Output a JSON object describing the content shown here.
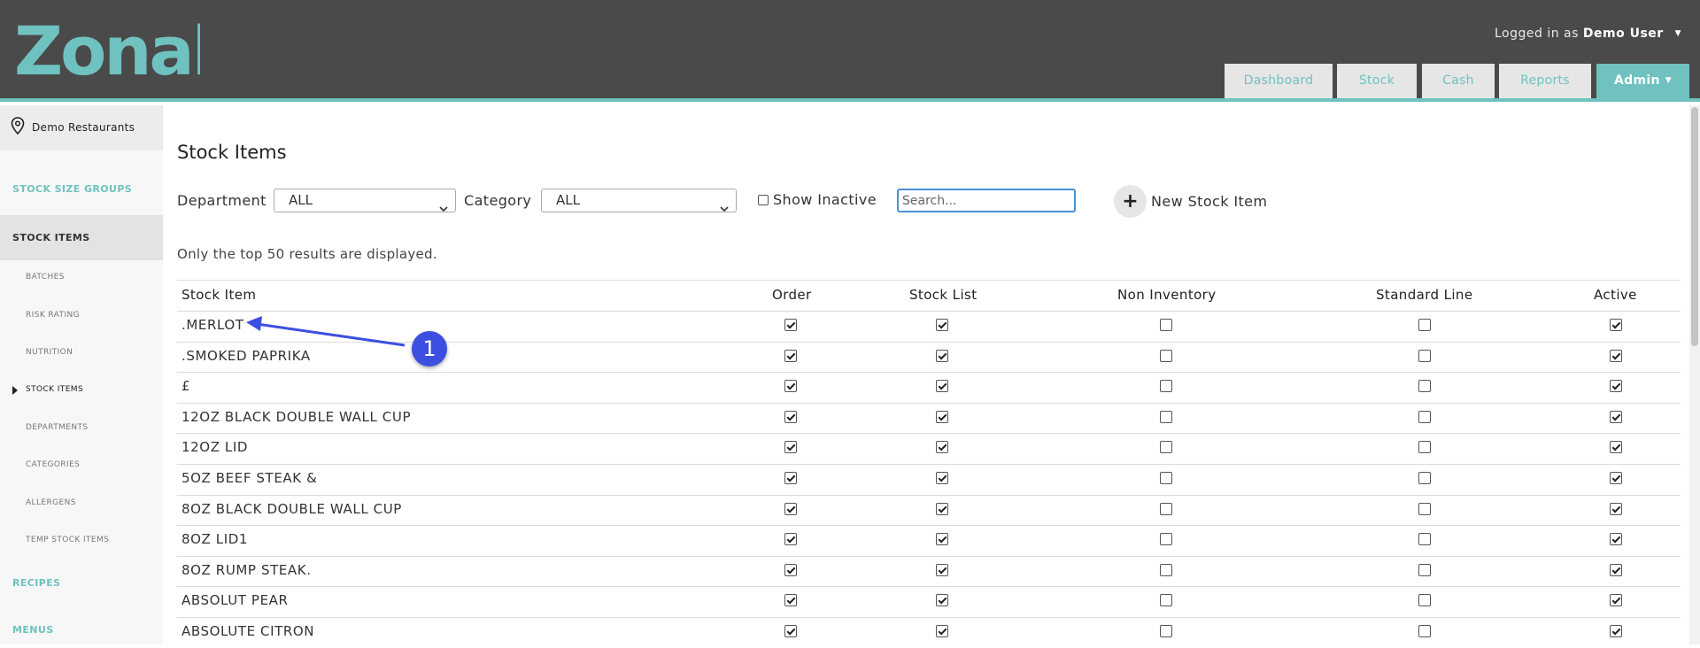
{
  "brand": {
    "logo_text": "Zonal"
  },
  "header": {
    "logged_in_prefix": "Logged in as",
    "user_name": "Demo User",
    "tabs": [
      {
        "label": "Dashboard"
      },
      {
        "label": "Stock"
      },
      {
        "label": "Cash"
      },
      {
        "label": "Reports"
      },
      {
        "label": "Admin",
        "active": true
      }
    ]
  },
  "sidebar": {
    "location": "Demo Restaurants",
    "sections": [
      {
        "label": "STOCK SIZE GROUPS"
      },
      {
        "label": "STOCK ITEMS",
        "selected": true
      },
      {
        "label": "RECIPES"
      },
      {
        "label": "MENUS"
      }
    ],
    "subitems": [
      {
        "label": "BATCHES"
      },
      {
        "label": "RISK RATING"
      },
      {
        "label": "NUTRITION"
      },
      {
        "label": "STOCK ITEMS",
        "current": true
      },
      {
        "label": "DEPARTMENTS"
      },
      {
        "label": "CATEGORIES"
      },
      {
        "label": "ALLERGENS"
      },
      {
        "label": "TEMP STOCK ITEMS"
      }
    ]
  },
  "main": {
    "title": "Stock Items",
    "filters": {
      "department_label": "Department",
      "department_value": "ALL",
      "category_label": "Category",
      "category_value": "ALL",
      "show_inactive_label": "Show Inactive",
      "show_inactive_checked": false,
      "search_placeholder": "Search...",
      "new_button_label": "New Stock Item"
    },
    "note": "Only the top 50 results are displayed.",
    "table": {
      "columns": [
        "Stock Item",
        "Order",
        "Stock List",
        "Non Inventory",
        "Standard Line",
        "Active"
      ],
      "rows": [
        {
          "name": ".MERLOT",
          "order": true,
          "stock_list": true,
          "non_inventory": false,
          "standard_line": false,
          "active": true
        },
        {
          "name": ".SMOKED PAPRIKA",
          "order": true,
          "stock_list": true,
          "non_inventory": false,
          "standard_line": false,
          "active": true
        },
        {
          "name": "£",
          "order": true,
          "stock_list": true,
          "non_inventory": false,
          "standard_line": false,
          "active": true
        },
        {
          "name": "12OZ BLACK DOUBLE WALL CUP",
          "order": true,
          "stock_list": true,
          "non_inventory": false,
          "standard_line": false,
          "active": true
        },
        {
          "name": "12OZ LID",
          "order": true,
          "stock_list": true,
          "non_inventory": false,
          "standard_line": false,
          "active": true
        },
        {
          "name": "5OZ BEEF STEAK &",
          "order": true,
          "stock_list": true,
          "non_inventory": false,
          "standard_line": false,
          "active": true
        },
        {
          "name": "8OZ BLACK DOUBLE WALL CUP",
          "order": true,
          "stock_list": true,
          "non_inventory": false,
          "standard_line": false,
          "active": true
        },
        {
          "name": "8OZ LID1",
          "order": true,
          "stock_list": true,
          "non_inventory": false,
          "standard_line": false,
          "active": true
        },
        {
          "name": "8OZ RUMP STEAK.",
          "order": true,
          "stock_list": true,
          "non_inventory": false,
          "standard_line": false,
          "active": true
        },
        {
          "name": "ABSOLUT PEAR",
          "order": true,
          "stock_list": true,
          "non_inventory": false,
          "standard_line": false,
          "active": true
        },
        {
          "name": "ABSOLUTE CITRON",
          "order": true,
          "stock_list": true,
          "non_inventory": false,
          "standard_line": false,
          "active": true
        }
      ]
    }
  },
  "annotation": {
    "badge_number": "1",
    "color": "#3d4fe0"
  },
  "colors": {
    "header_bg": "#4a4a4a",
    "accent": "#6fc2bf",
    "tab_bg": "#e6e6e6"
  }
}
